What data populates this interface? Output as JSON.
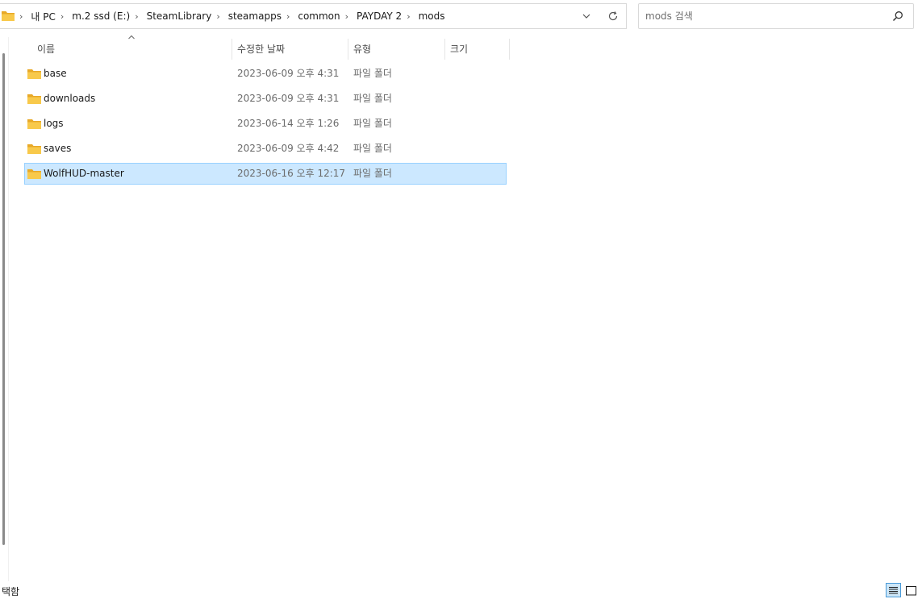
{
  "address_bar": {
    "breadcrumbs": [
      "내 PC",
      "m.2 ssd (E:)",
      "SteamLibrary",
      "steamapps",
      "common",
      "PAYDAY 2",
      "mods"
    ]
  },
  "search": {
    "placeholder": "mods 검색",
    "value": ""
  },
  "columns": {
    "name": "이름",
    "date_modified": "수정한 날짜",
    "type": "유형",
    "size": "크기"
  },
  "files": [
    {
      "name": "base",
      "date": "2023-06-09 오후 4:31",
      "type": "파일 폴더",
      "selected": false
    },
    {
      "name": "downloads",
      "date": "2023-06-09 오후 4:31",
      "type": "파일 폴더",
      "selected": false
    },
    {
      "name": "logs",
      "date": "2023-06-14 오후 1:26",
      "type": "파일 폴더",
      "selected": false
    },
    {
      "name": "saves",
      "date": "2023-06-09 오후 4:42",
      "type": "파일 폴더",
      "selected": false
    },
    {
      "name": "WolfHUD-master",
      "date": "2023-06-16 오후 12:17",
      "type": "파일 폴더",
      "selected": true
    }
  ],
  "status_bar": {
    "text": "택함"
  },
  "icons": {
    "address": "folder-icon",
    "breadcrumb_separator": "chevron-right-icon",
    "dropdown": "chevron-down-icon",
    "refresh": "refresh-icon",
    "search": "search-icon",
    "sort": "sort-ascending-icon",
    "file": "folder-icon",
    "details_view": "details-view-icon",
    "large_icons_view": "large-icons-view-icon"
  },
  "colors": {
    "selection_bg": "#cce8ff",
    "selection_border": "#99d1ff",
    "folder_yellow": "#f8c94b"
  }
}
